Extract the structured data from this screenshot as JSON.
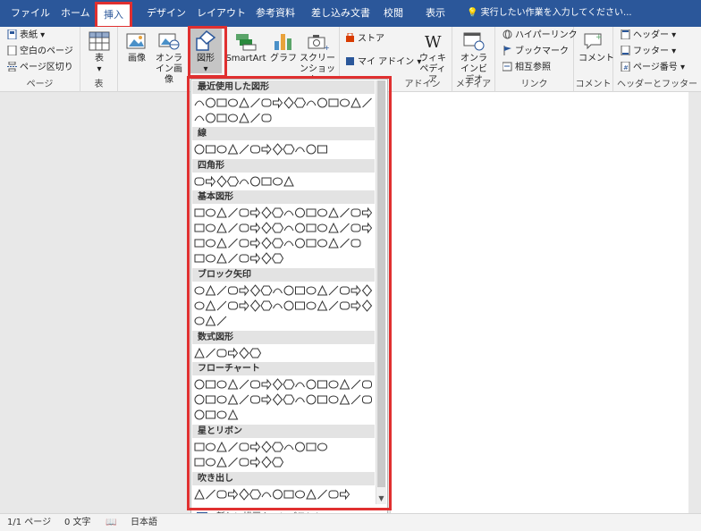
{
  "tabs": [
    "ファイル",
    "ホーム",
    "挿入",
    "デザイン",
    "レイアウト",
    "参考資料",
    "差し込み文書",
    "校閲",
    "表示"
  ],
  "tell_me": "実行したい作業を入力してください...",
  "groups": {
    "page": {
      "label": "ページ",
      "items": [
        "表紙",
        "空白のページ",
        "ページ区切り"
      ]
    },
    "table": {
      "label": "表",
      "button": "表"
    },
    "illustrations": {
      "buttons": [
        "画像",
        "オンライン画像",
        "図形",
        "SmartArt",
        "グラフ",
        "スクリーンショット"
      ]
    },
    "addins": {
      "label": "アドイン",
      "items": [
        "ストア",
        "マイ アドイン"
      ],
      "wiki": "ウィキペディア"
    },
    "media": {
      "label": "メディア",
      "button": "オンラインビデオ"
    },
    "links": {
      "label": "リンク",
      "items": [
        "ハイパーリンク",
        "ブックマーク",
        "相互参照"
      ]
    },
    "comments": {
      "label": "コメント",
      "button": "コメント"
    },
    "header_footer": {
      "label": "ヘッダーとフッター",
      "items": [
        "ヘッダー",
        "フッター",
        "ページ番号"
      ]
    }
  },
  "shapes_panel": {
    "sections": [
      "最近使用した図形",
      "線",
      "四角形",
      "基本図形",
      "ブロック矢印",
      "数式図形",
      "フローチャート",
      "星とリボン",
      "吹き出し"
    ],
    "new_canvas": "新しい描画キャンバス(N)"
  },
  "status": {
    "page": "1/1 ページ",
    "words": "0 文字",
    "lang": "日本語"
  },
  "colors": {
    "accent": "#2b579a",
    "highlight": "#e03030"
  }
}
